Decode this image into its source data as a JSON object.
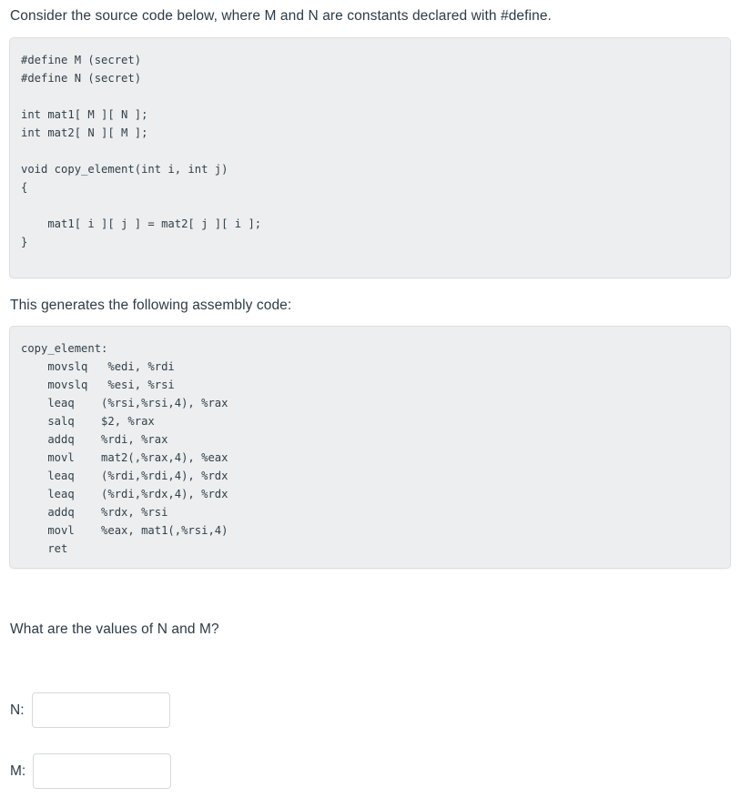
{
  "page": {
    "intro_text": "Consider the source code below, where M and N are constants declared with #define.",
    "assembly_intro_text": "This generates the following assembly code:",
    "question_text": "What are the values of N and M?"
  },
  "source_code": {
    "language": "c",
    "lines": [
      "#define M (secret)",
      "#define N (secret)",
      "",
      "int mat1[ M ][ N ];",
      "int mat2[ N ][ M ];",
      "",
      "void copy_element(int i, int j)",
      "{",
      "",
      "    mat1[ i ][ j ] = mat2[ j ][ i ];",
      "}"
    ]
  },
  "assembly_code": {
    "language": "x86-64-att",
    "lines": [
      "copy_element:",
      "    movslq   %edi, %rdi",
      "    movslq   %esi, %rsi",
      "    leaq    (%rsi,%rsi,4), %rax",
      "    salq    $2, %rax",
      "    addq    %rdi, %rax",
      "    movl    mat2(,%rax,4), %eax",
      "    leaq    (%rdi,%rdi,4), %rdx",
      "    leaq    (%rdi,%rdx,4), %rdx",
      "    addq    %rdx, %rsi",
      "    movl    %eax, mat1(,%rsi,4)",
      "    ret"
    ]
  },
  "answers": [
    {
      "label": "N:",
      "value": "",
      "placeholder": ""
    },
    {
      "label": "M:",
      "value": "",
      "placeholder": ""
    }
  ],
  "colors": {
    "code_background": "#eceeef",
    "code_border": "#dcdfe1",
    "text": "#2d3b45",
    "input_border": "#d6d9db",
    "page_background": "#ffffff"
  }
}
